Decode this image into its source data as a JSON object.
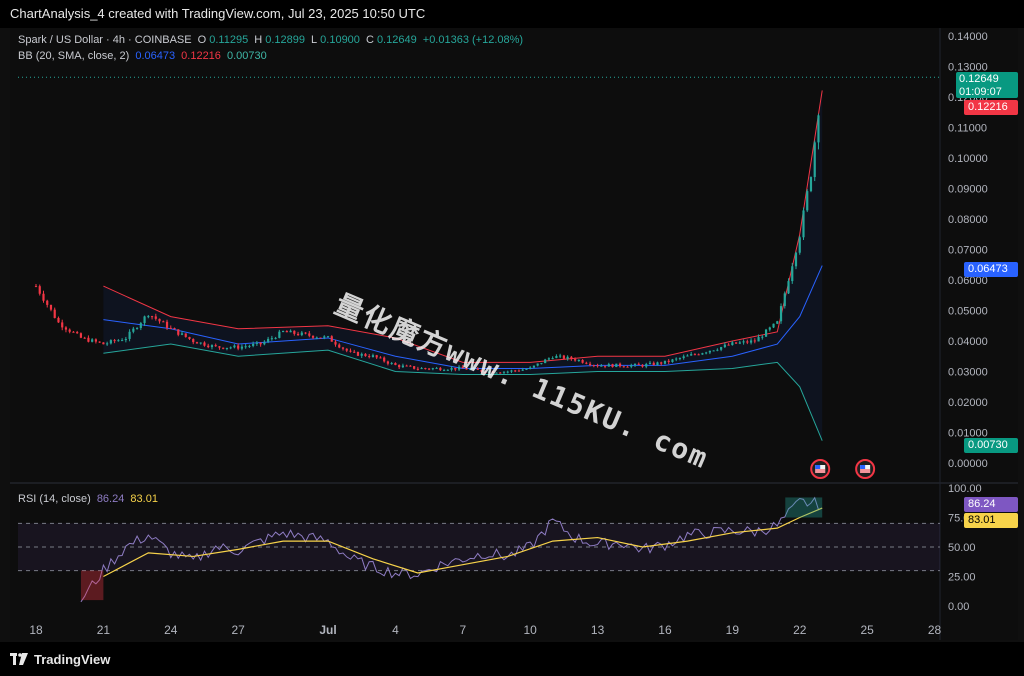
{
  "header": {
    "caption": "ChartAnalysis_4 created with TradingView.com, Jul 23, 2025 10:50 UTC"
  },
  "footer": {
    "brand": "TradingView"
  },
  "watermark": "量化魔方www. 115KU. com",
  "legend": {
    "symbol": "Spark / US Dollar · 4h · COINBASE",
    "o_label": "O",
    "o_value": "0.11295",
    "h_label": "H",
    "h_value": "0.12899",
    "l_label": "L",
    "l_value": "0.10900",
    "c_label": "C",
    "c_value": "0.12649",
    "change": "+0.01363 (+12.08%)",
    "bb_name": "BB (20, SMA, close, 2)",
    "bb_basis": "0.06473",
    "bb_upper": "0.12216",
    "bb_lower": "0.00730",
    "rsi_name": "RSI (14, close)",
    "rsi_value": "86.24",
    "rsi_ma": "83.01"
  },
  "price_badges": {
    "last": "0.12649",
    "countdown": "01:09:07",
    "upper": "0.12216",
    "basis": "0.06473",
    "lower": "0.00730"
  },
  "rsi_badges": {
    "rsi": "86.24",
    "ma": "83.01"
  },
  "colors": {
    "up": "#26a69a",
    "down": "#f23645",
    "basis": "#2962ff",
    "upper": "#f23645",
    "lower": "#26a69a",
    "rsi": "#8e7cc3",
    "rsi_ma": "#f7d34a",
    "bg": "#0d0d0d"
  },
  "chart_data": [
    {
      "type": "candlestick",
      "title": "Spark / US Dollar · 4h · COINBASE",
      "x_tick_labels": [
        "18",
        "21",
        "24",
        "27",
        "Jul",
        "4",
        "7",
        "10",
        "13",
        "16",
        "19",
        "22",
        "25",
        "28"
      ],
      "y_tick_labels": [
        "0.14000",
        "0.13000",
        "0.12000",
        "0.11000",
        "0.10000",
        "0.09000",
        "0.08000",
        "0.07000",
        "0.06000",
        "0.05000",
        "0.04000",
        "0.03000",
        "0.02000",
        "0.01000",
        "0.00000"
      ],
      "ylim": [
        0.0,
        0.14
      ],
      "grid": false,
      "series": [
        {
          "name": "Close (approx.)",
          "points": [
            {
              "x": "Jun 18",
              "y": 0.058
            },
            {
              "x": "Jun 19",
              "y": 0.046
            },
            {
              "x": "Jun 20",
              "y": 0.041
            },
            {
              "x": "Jun 21",
              "y": 0.039
            },
            {
              "x": "Jun 22",
              "y": 0.041
            },
            {
              "x": "Jun 23",
              "y": 0.049
            },
            {
              "x": "Jun 24",
              "y": 0.044
            },
            {
              "x": "Jun 25",
              "y": 0.04
            },
            {
              "x": "Jun 26",
              "y": 0.038
            },
            {
              "x": "Jun 27",
              "y": 0.038
            },
            {
              "x": "Jun 28",
              "y": 0.039
            },
            {
              "x": "Jun 29",
              "y": 0.043
            },
            {
              "x": "Jul 1",
              "y": 0.041
            },
            {
              "x": "Jul 2",
              "y": 0.036
            },
            {
              "x": "Jul 3",
              "y": 0.035
            },
            {
              "x": "Jul 4",
              "y": 0.032
            },
            {
              "x": "Jul 5",
              "y": 0.031
            },
            {
              "x": "Jul 6",
              "y": 0.031
            },
            {
              "x": "Jul 7",
              "y": 0.031
            },
            {
              "x": "Jul 8",
              "y": 0.03
            },
            {
              "x": "Jul 9",
              "y": 0.03
            },
            {
              "x": "Jul 10",
              "y": 0.031
            },
            {
              "x": "Jul 11",
              "y": 0.035
            },
            {
              "x": "Jul 12",
              "y": 0.034
            },
            {
              "x": "Jul 13",
              "y": 0.032
            },
            {
              "x": "Jul 14",
              "y": 0.032
            },
            {
              "x": "Jul 15",
              "y": 0.032
            },
            {
              "x": "Jul 16",
              "y": 0.033
            },
            {
              "x": "Jul 17",
              "y": 0.035
            },
            {
              "x": "Jul 18",
              "y": 0.037
            },
            {
              "x": "Jul 19",
              "y": 0.039
            },
            {
              "x": "Jul 20",
              "y": 0.04
            },
            {
              "x": "Jul 21",
              "y": 0.046
            },
            {
              "x": "Jul 22",
              "y": 0.075
            },
            {
              "x": "Jul 22 12h",
              "y": 0.095
            },
            {
              "x": "Jul 23",
              "y": 0.12649
            }
          ]
        },
        {
          "name": "BB Upper (approx.)",
          "values_note": "",
          "points": [
            {
              "x": "Jun 21",
              "y": 0.058
            },
            {
              "x": "Jun 24",
              "y": 0.048
            },
            {
              "x": "Jun 27",
              "y": 0.044
            },
            {
              "x": "Jul 1",
              "y": 0.045
            },
            {
              "x": "Jul 4",
              "y": 0.041
            },
            {
              "x": "Jul 7",
              "y": 0.033
            },
            {
              "x": "Jul 10",
              "y": 0.033
            },
            {
              "x": "Jul 13",
              "y": 0.035
            },
            {
              "x": "Jul 16",
              "y": 0.035
            },
            {
              "x": "Jul 19",
              "y": 0.04
            },
            {
              "x": "Jul 21",
              "y": 0.043
            },
            {
              "x": "Jul 22",
              "y": 0.075
            },
            {
              "x": "Jul 23",
              "y": 0.12216
            }
          ]
        },
        {
          "name": "BB Basis (approx.)",
          "points": [
            {
              "x": "Jun 21",
              "y": 0.047
            },
            {
              "x": "Jun 24",
              "y": 0.044
            },
            {
              "x": "Jun 27",
              "y": 0.039
            },
            {
              "x": "Jul 1",
              "y": 0.041
            },
            {
              "x": "Jul 4",
              "y": 0.035
            },
            {
              "x": "Jul 7",
              "y": 0.031
            },
            {
              "x": "Jul 10",
              "y": 0.031
            },
            {
              "x": "Jul 13",
              "y": 0.032
            },
            {
              "x": "Jul 16",
              "y": 0.032
            },
            {
              "x": "Jul 19",
              "y": 0.035
            },
            {
              "x": "Jul 21",
              "y": 0.039
            },
            {
              "x": "Jul 22",
              "y": 0.048
            },
            {
              "x": "Jul 23",
              "y": 0.06473
            }
          ]
        },
        {
          "name": "BB Lower (approx.)",
          "points": [
            {
              "x": "Jun 21",
              "y": 0.036
            },
            {
              "x": "Jun 24",
              "y": 0.039
            },
            {
              "x": "Jun 27",
              "y": 0.035
            },
            {
              "x": "Jul 1",
              "y": 0.037
            },
            {
              "x": "Jul 4",
              "y": 0.03
            },
            {
              "x": "Jul 7",
              "y": 0.029
            },
            {
              "x": "Jul 10",
              "y": 0.029
            },
            {
              "x": "Jul 13",
              "y": 0.03
            },
            {
              "x": "Jul 16",
              "y": 0.03
            },
            {
              "x": "Jul 19",
              "y": 0.031
            },
            {
              "x": "Jul 21",
              "y": 0.033
            },
            {
              "x": "Jul 22",
              "y": 0.025
            },
            {
              "x": "Jul 23",
              "y": 0.0073
            }
          ]
        }
      ]
    },
    {
      "type": "line",
      "title": "RSI (14, close)",
      "y_tick_labels": [
        "100.00",
        "75.00",
        "50.00",
        "25.00",
        "0.00"
      ],
      "ylim": [
        0,
        100
      ],
      "grid": false,
      "bands": [
        30,
        70
      ],
      "series": [
        {
          "name": "RSI",
          "points": [
            {
              "x": "Jun 20",
              "y": 5
            },
            {
              "x": "Jun 21",
              "y": 30
            },
            {
              "x": "Jun 22",
              "y": 50
            },
            {
              "x": "Jun 23",
              "y": 60
            },
            {
              "x": "Jun 24",
              "y": 45
            },
            {
              "x": "Jun 25",
              "y": 38
            },
            {
              "x": "Jun 26",
              "y": 50
            },
            {
              "x": "Jun 27",
              "y": 47
            },
            {
              "x": "Jun 28",
              "y": 55
            },
            {
              "x": "Jun 29",
              "y": 62
            },
            {
              "x": "Jul 1",
              "y": 55
            },
            {
              "x": "Jul 2",
              "y": 40
            },
            {
              "x": "Jul 3",
              "y": 33
            },
            {
              "x": "Jul 4",
              "y": 28
            },
            {
              "x": "Jul 5",
              "y": 27
            },
            {
              "x": "Jul 6",
              "y": 35
            },
            {
              "x": "Jul 7",
              "y": 40
            },
            {
              "x": "Jul 8",
              "y": 45
            },
            {
              "x": "Jul 9",
              "y": 42
            },
            {
              "x": "Jul 10",
              "y": 50
            },
            {
              "x": "Jul 11",
              "y": 72
            },
            {
              "x": "Jul 12",
              "y": 58
            },
            {
              "x": "Jul 13",
              "y": 52
            },
            {
              "x": "Jul 14",
              "y": 54
            },
            {
              "x": "Jul 15",
              "y": 48
            },
            {
              "x": "Jul 16",
              "y": 52
            },
            {
              "x": "Jul 17",
              "y": 60
            },
            {
              "x": "Jul 18",
              "y": 62
            },
            {
              "x": "Jul 19",
              "y": 64
            },
            {
              "x": "Jul 20",
              "y": 63
            },
            {
              "x": "Jul 21",
              "y": 68
            },
            {
              "x": "Jul 22",
              "y": 88
            },
            {
              "x": "Jul 23",
              "y": 86.24
            }
          ]
        },
        {
          "name": "RSI MA",
          "points": [
            {
              "x": "Jun 21",
              "y": 25
            },
            {
              "x": "Jun 23",
              "y": 45
            },
            {
              "x": "Jun 25",
              "y": 42
            },
            {
              "x": "Jun 27",
              "y": 48
            },
            {
              "x": "Jun 29",
              "y": 55
            },
            {
              "x": "Jul 1",
              "y": 55
            },
            {
              "x": "Jul 3",
              "y": 40
            },
            {
              "x": "Jul 5",
              "y": 28
            },
            {
              "x": "Jul 7",
              "y": 35
            },
            {
              "x": "Jul 9",
              "y": 42
            },
            {
              "x": "Jul 11",
              "y": 55
            },
            {
              "x": "Jul 13",
              "y": 58
            },
            {
              "x": "Jul 15",
              "y": 50
            },
            {
              "x": "Jul 17",
              "y": 55
            },
            {
              "x": "Jul 19",
              "y": 62
            },
            {
              "x": "Jul 21",
              "y": 66
            },
            {
              "x": "Jul 22",
              "y": 75
            },
            {
              "x": "Jul 23",
              "y": 83.01
            }
          ]
        }
      ]
    }
  ]
}
